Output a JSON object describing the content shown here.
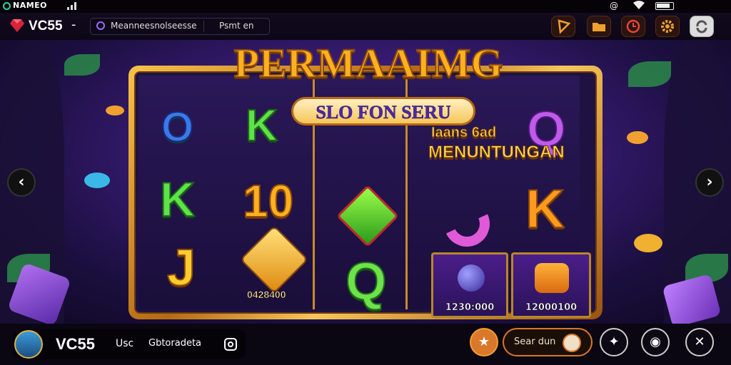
{
  "status_bar": {
    "title": "NAMEO",
    "right_icons": [
      "at-icon",
      "wifi-icon",
      "battery-icon"
    ]
  },
  "app_bar": {
    "logo_text": "VC55",
    "logo_dash": "-",
    "search_placeholder": "Meanneesnolseesse",
    "search_button": "Psmt en",
    "buttons": [
      "flag-icon",
      "folder-icon",
      "clock-icon",
      "gear-icon",
      "refresh-icon"
    ],
    "accent_color": "#f0a030"
  },
  "game": {
    "title": "PERMAAIMG",
    "subtitle": "SLO FON SERU",
    "promo_line1": "Iaans 6ad",
    "promo_line2": "MENUNTUNGAN",
    "reel1": {
      "top": "O",
      "mid": "K",
      "bottom": "J"
    },
    "reel2": {
      "top": "K",
      "mid": "10",
      "gem_value": "0428400"
    },
    "reel3": {
      "bottom": "Q"
    },
    "reel4": {
      "top": "Q",
      "mid": "K"
    },
    "tiles": [
      {
        "value": "1230:000"
      },
      {
        "value": "12000100"
      }
    ]
  },
  "bottom_bar": {
    "brand": "VC55",
    "label": "Usc",
    "provider": "Gbtoradeta",
    "search_button": "Sear dun"
  }
}
